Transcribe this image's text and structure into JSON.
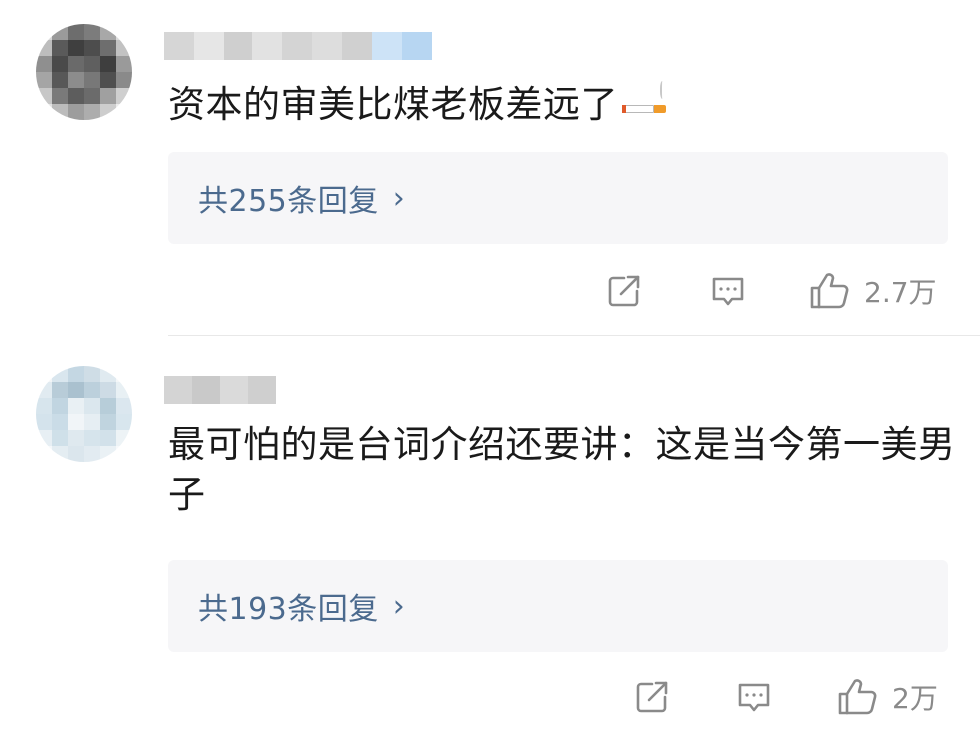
{
  "comments": [
    {
      "text": "资本的审美比煤老板差远了",
      "emoji": "cigarette",
      "replies_label": "共255条回复",
      "reply_chevron": "›",
      "likes": "2.7万"
    },
    {
      "text": "最可怕的是台词介绍还要讲：这是当今第一美男子",
      "replies_label": "共193条回复",
      "reply_chevron": "›",
      "likes": "2万"
    }
  ],
  "icons": {
    "share": "share-icon",
    "comment": "comment-icon",
    "like": "thumbs-up-icon"
  }
}
